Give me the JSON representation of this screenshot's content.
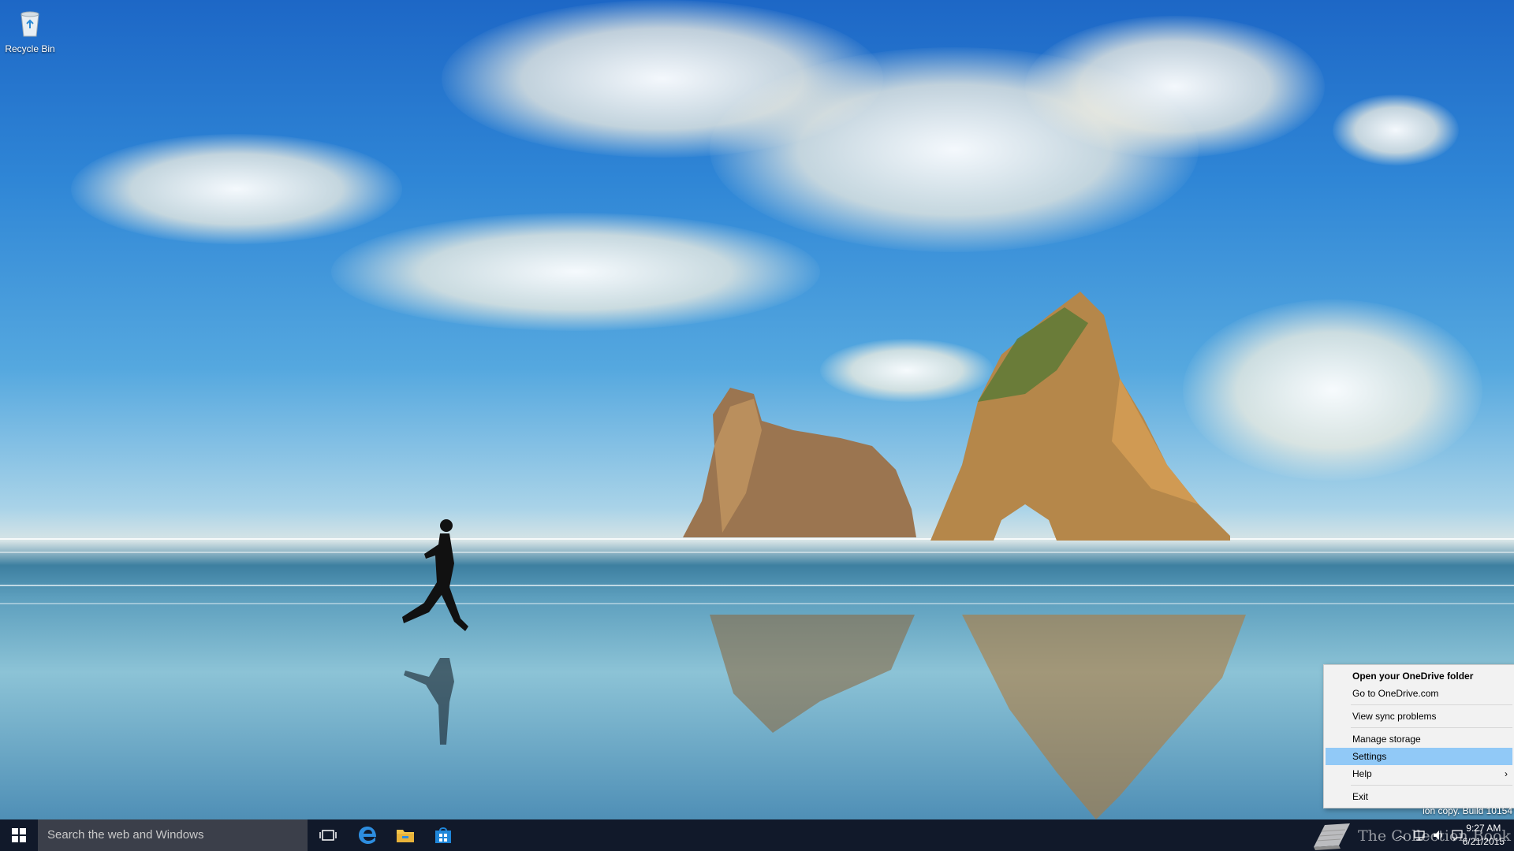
{
  "desktop": {
    "icons": [
      {
        "label": "Recycle Bin",
        "icon": "recycle-bin-icon"
      }
    ],
    "watermark": "ion copy. Build 10154"
  },
  "context_menu": {
    "items": [
      {
        "label": "Open your OneDrive folder",
        "bold": true
      },
      {
        "label": "Go to OneDrive.com"
      },
      {
        "label": "View sync problems"
      },
      {
        "label": "Manage storage"
      },
      {
        "label": "Settings",
        "highlighted": true
      },
      {
        "label": "Help",
        "submenu": true
      },
      {
        "label": "Exit"
      }
    ],
    "submenu_arrow": "›",
    "highlight_color": "#91c9f7"
  },
  "taskbar": {
    "search_placeholder": "Search the web and Windows",
    "pinned": [
      "task-view-icon",
      "edge-icon",
      "file-explorer-icon",
      "store-icon"
    ],
    "tray_overlay_text": "The Collection Book",
    "clock": {
      "time": "9:27 AM",
      "date": "6/21/2015"
    },
    "tray_icons": [
      "chevron-up-icon",
      "network-icon",
      "volume-icon",
      "action-center-icon"
    ],
    "background": "#11192a"
  }
}
